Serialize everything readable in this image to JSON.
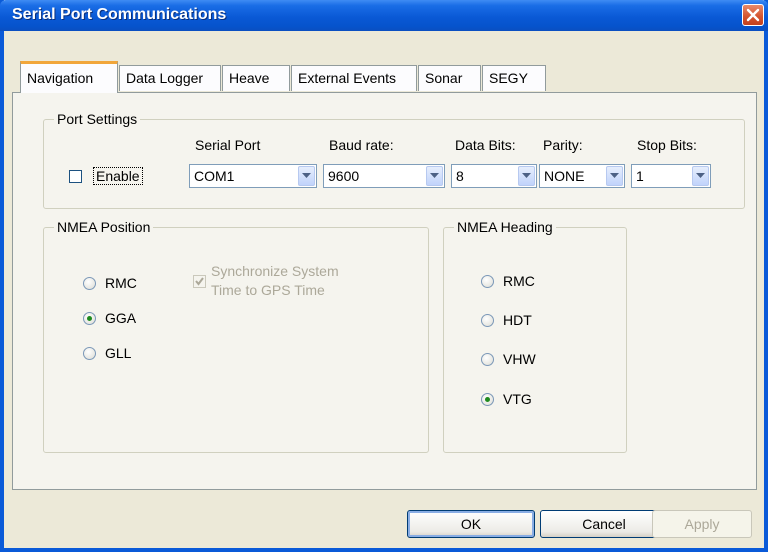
{
  "window": {
    "title": "Serial Port Communications"
  },
  "tabs": [
    {
      "label": "Navigation"
    },
    {
      "label": "Data Logger"
    },
    {
      "label": "Heave"
    },
    {
      "label": "External Events"
    },
    {
      "label": "Sonar"
    },
    {
      "label": "SEGY"
    }
  ],
  "port_settings": {
    "legend": "Port Settings",
    "enable_label": "Enable",
    "enable_checked": false,
    "serial_port": {
      "label": "Serial Port",
      "value": "COM1"
    },
    "baud_rate": {
      "label": "Baud rate:",
      "value": "9600"
    },
    "data_bits": {
      "label": "Data Bits:",
      "value": "8"
    },
    "parity": {
      "label": "Parity:",
      "value": "NONE"
    },
    "stop_bits": {
      "label": "Stop Bits:",
      "value": "1"
    }
  },
  "nmea_position": {
    "legend": "NMEA Position",
    "options": [
      "RMC",
      "GGA",
      "GLL"
    ],
    "selected": "GGA",
    "sync_line1": "Synchronize System",
    "sync_line2": "Time to GPS Time"
  },
  "nmea_heading": {
    "legend": "NMEA Heading",
    "options": [
      "RMC",
      "HDT",
      "VHW",
      "VTG"
    ],
    "selected": "VTG"
  },
  "buttons": {
    "ok": "OK",
    "cancel": "Cancel",
    "apply": "Apply"
  }
}
